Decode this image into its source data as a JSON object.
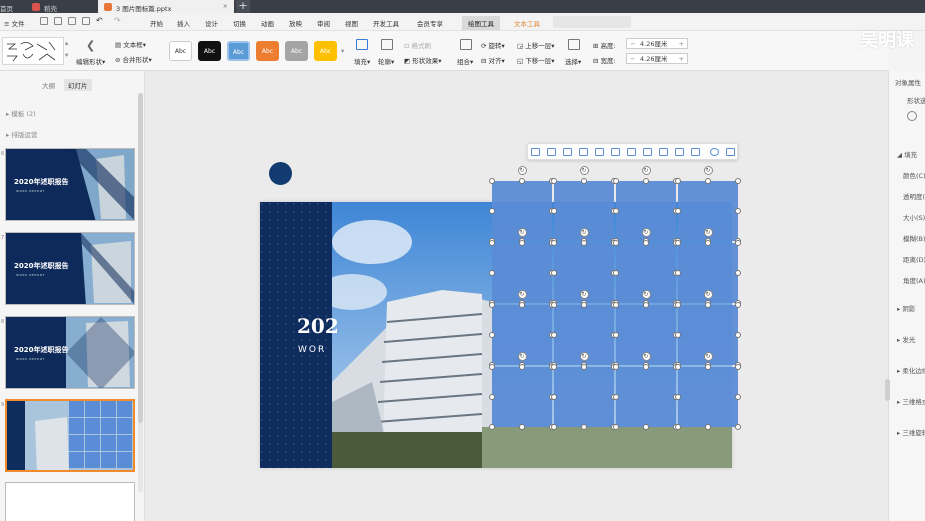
{
  "titlebar": {
    "tabs": [
      {
        "label": "首页"
      },
      {
        "label": "稻壳"
      },
      {
        "label": "3 图片图标篇.pptx"
      }
    ],
    "new_tab": "+"
  },
  "menubar": {
    "file": "文件",
    "items": [
      "开始",
      "插入",
      "设计",
      "切换",
      "动画",
      "放映",
      "审阅",
      "视图",
      "开发工具",
      "会员专享"
    ],
    "drawing_tools": "绘图工具",
    "text_tools": "文本工具"
  },
  "ribbon": {
    "edit_shape": "编辑形状",
    "text_box": "文本框",
    "merge_shape": "合并形状",
    "style_labels": [
      "Abc",
      "Abc",
      "Abc",
      "Abc",
      "Abc",
      "Abc"
    ],
    "fill": "填充",
    "outline": "轮廓",
    "shape_effect": "形状效果",
    "format_painter": "格式刷",
    "group": "组合",
    "rotate": "旋转",
    "align": "对齐",
    "bring_forward": "上移一层",
    "send_backward": "下移一层",
    "select": "选择",
    "height_label": "高度:",
    "height_value": "4.26厘米",
    "width_label": "宽度:",
    "width_value": "4.26厘米",
    "minus": "−",
    "plus": "+"
  },
  "watermark": "吴明课",
  "leftpanel": {
    "tab_outline": "大纲",
    "tab_slides": "幻灯片",
    "section_template": "模板 (2)",
    "section_layout": "排版运营",
    "thumbs": [
      {
        "num": "6",
        "title": "2020年述职报告",
        "subtitle": "WORK REPORT"
      },
      {
        "num": "7",
        "title": "2020年述职报告",
        "subtitle": "WORK REPORT"
      },
      {
        "num": "8",
        "title": "2020年述职报告",
        "subtitle": "WORK REPORT"
      },
      {
        "num": "9"
      }
    ]
  },
  "slide": {
    "year": "202",
    "subtitle": "WOR"
  },
  "rightpanel": {
    "title": "对象属性",
    "tab": "形状选",
    "fill_section": "填充",
    "props": [
      "颜色(C)",
      "透明度(",
      "大小(S)",
      "模糊(B)",
      "距离(D)",
      "角度(A)"
    ],
    "sections": [
      "阴影",
      "发光",
      "柔化边缘",
      "三维格式",
      "三维旋转"
    ]
  },
  "colors": {
    "navy": "#0e2d5e",
    "cell_blue": "#5b8cd6",
    "accent_orange": "#f08a2a",
    "style_black": "#111111",
    "style_blue": "#5b9bd5",
    "style_orange": "#ed7d31",
    "style_gray": "#a5a5a5",
    "style_yellow": "#ffc000"
  }
}
